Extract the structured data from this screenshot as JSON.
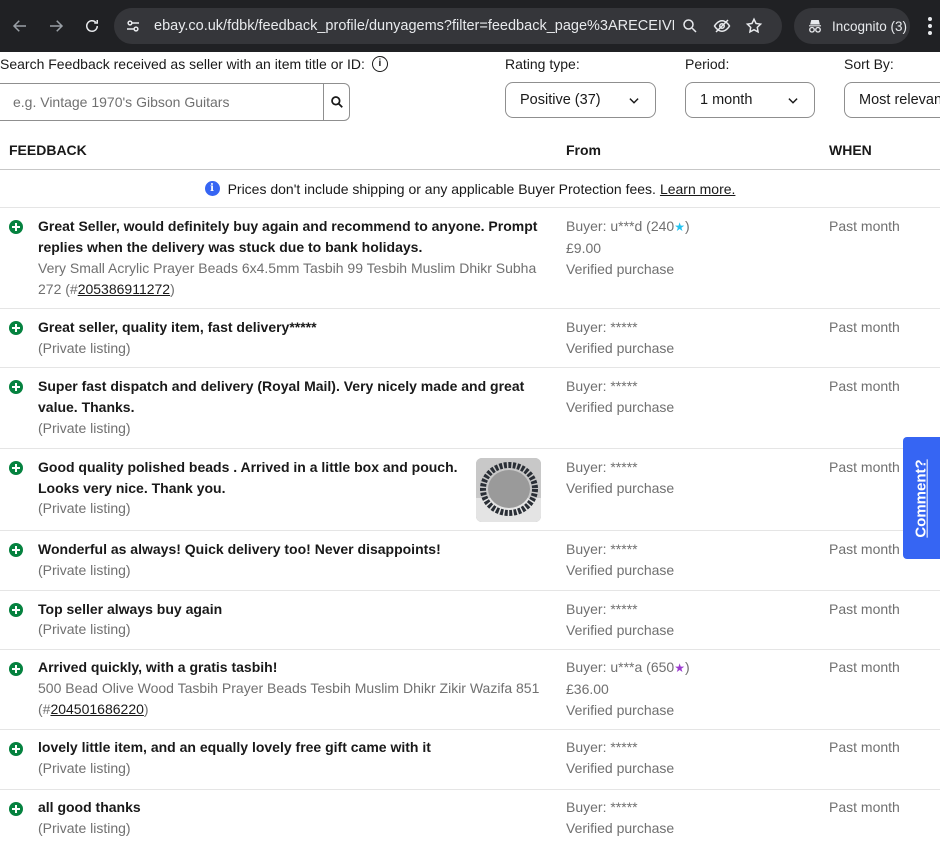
{
  "browser": {
    "url": "ebay.co.uk/fdbk/feedback_profile/dunyagems?filter=feedback_page%3ARECEIVED...",
    "profile_label": "Incognito (3)"
  },
  "filters": {
    "search_label": "Search Feedback received as seller with an item title or ID:",
    "search_placeholder": "e.g. Vintage 1970's Gibson Guitars",
    "rating_label": "Rating type:",
    "rating_value": "Positive (37)",
    "period_label": "Period:",
    "period_value": "1 month",
    "sort_label": "Sort By:",
    "sort_value": "Most relevant"
  },
  "table": {
    "headers": {
      "feedback": "FEEDBACK",
      "from": "From",
      "when": "WHEN"
    },
    "notice": "Prices don't include shipping or any applicable Buyer Protection fees.",
    "notice_link": "Learn more.",
    "rows": [
      {
        "comment": "Great Seller, would definitely buy again and recommend to anyone. Prompt replies when the delivery was stuck due to bank holidays.",
        "item_title": "Very Small Acrylic Prayer Beads 6x4.5mm Tasbih 99 Tesbih Muslim Dhikr Subha 272",
        "item_id": "205386911272",
        "buyer": "Buyer: u***d (240",
        "star_color": "#23c3f0",
        "price": "£9.00",
        "verified": "Verified purchase",
        "when": "Past month"
      },
      {
        "comment": "Great seller, quality item, fast delivery*****",
        "item": "(Private listing)",
        "buyer": "Buyer: *****",
        "verified": "Verified purchase",
        "when": "Past month"
      },
      {
        "comment": "Super fast dispatch and delivery (Royal Mail). Very nicely made and great value. Thanks.",
        "item": "(Private listing)",
        "buyer": "Buyer: *****",
        "verified": "Verified purchase",
        "when": "Past month"
      },
      {
        "comment": "Good quality polished beads . Arrived in a little box and pouch. Looks very nice. Thank you.",
        "item": "(Private listing)",
        "buyer": "Buyer: *****",
        "verified": "Verified purchase",
        "when": "Past month"
      },
      {
        "comment": "Wonderful as always! Quick delivery too! Never disappoints!",
        "item": "(Private listing)",
        "buyer": "Buyer: *****",
        "verified": "Verified purchase",
        "when": "Past month"
      },
      {
        "comment": "Top seller always buy again",
        "item": "(Private listing)",
        "buyer": "Buyer: *****",
        "verified": "Verified purchase",
        "when": "Past month"
      },
      {
        "comment": "Arrived quickly, with a gratis tasbih!",
        "item_title": "500 Bead Olive Wood Tasbih Prayer Beads Tesbih Muslim Dhikr Zikir Wazifa 851",
        "item_id": "204501686220",
        "buyer": "Buyer: u***a (650",
        "star_color": "#9c3bd0",
        "price": "£36.00",
        "verified": "Verified purchase",
        "when": "Past month"
      },
      {
        "comment": "lovely little item, and an equally lovely free gift came with it",
        "item": "(Private listing)",
        "buyer": "Buyer: *****",
        "verified": "Verified purchase",
        "when": "Past month"
      },
      {
        "comment": "all good thanks",
        "item": "(Private listing)",
        "buyer": "Buyer: *****",
        "verified": "Verified purchase",
        "when": "Past month"
      }
    ]
  },
  "side_tab": "Comment?"
}
